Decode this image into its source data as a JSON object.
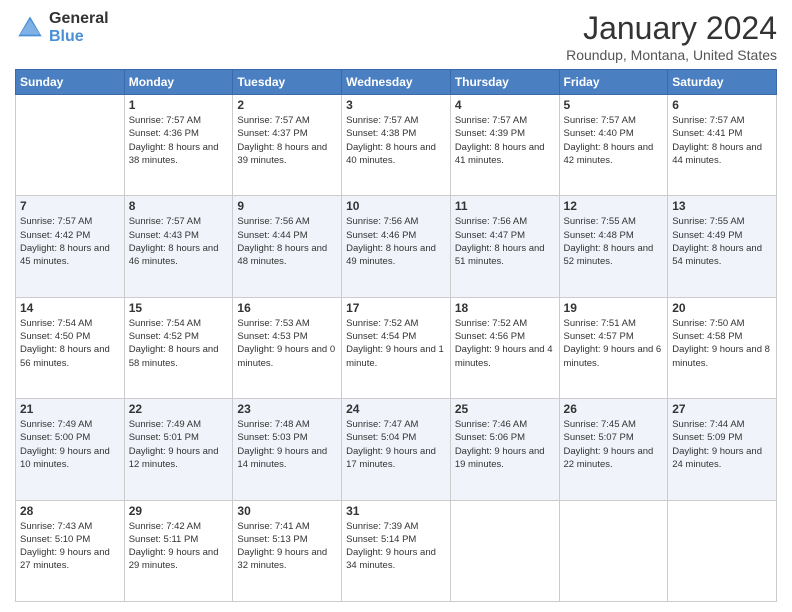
{
  "header": {
    "logo_general": "General",
    "logo_blue": "Blue",
    "month_title": "January 2024",
    "location": "Roundup, Montana, United States"
  },
  "weekdays": [
    "Sunday",
    "Monday",
    "Tuesday",
    "Wednesday",
    "Thursday",
    "Friday",
    "Saturday"
  ],
  "weeks": [
    [
      {
        "day": "",
        "sunrise": "",
        "sunset": "",
        "daylight": ""
      },
      {
        "day": "1",
        "sunrise": "Sunrise: 7:57 AM",
        "sunset": "Sunset: 4:36 PM",
        "daylight": "Daylight: 8 hours and 38 minutes."
      },
      {
        "day": "2",
        "sunrise": "Sunrise: 7:57 AM",
        "sunset": "Sunset: 4:37 PM",
        "daylight": "Daylight: 8 hours and 39 minutes."
      },
      {
        "day": "3",
        "sunrise": "Sunrise: 7:57 AM",
        "sunset": "Sunset: 4:38 PM",
        "daylight": "Daylight: 8 hours and 40 minutes."
      },
      {
        "day": "4",
        "sunrise": "Sunrise: 7:57 AM",
        "sunset": "Sunset: 4:39 PM",
        "daylight": "Daylight: 8 hours and 41 minutes."
      },
      {
        "day": "5",
        "sunrise": "Sunrise: 7:57 AM",
        "sunset": "Sunset: 4:40 PM",
        "daylight": "Daylight: 8 hours and 42 minutes."
      },
      {
        "day": "6",
        "sunrise": "Sunrise: 7:57 AM",
        "sunset": "Sunset: 4:41 PM",
        "daylight": "Daylight: 8 hours and 44 minutes."
      }
    ],
    [
      {
        "day": "7",
        "sunrise": "Sunrise: 7:57 AM",
        "sunset": "Sunset: 4:42 PM",
        "daylight": "Daylight: 8 hours and 45 minutes."
      },
      {
        "day": "8",
        "sunrise": "Sunrise: 7:57 AM",
        "sunset": "Sunset: 4:43 PM",
        "daylight": "Daylight: 8 hours and 46 minutes."
      },
      {
        "day": "9",
        "sunrise": "Sunrise: 7:56 AM",
        "sunset": "Sunset: 4:44 PM",
        "daylight": "Daylight: 8 hours and 48 minutes."
      },
      {
        "day": "10",
        "sunrise": "Sunrise: 7:56 AM",
        "sunset": "Sunset: 4:46 PM",
        "daylight": "Daylight: 8 hours and 49 minutes."
      },
      {
        "day": "11",
        "sunrise": "Sunrise: 7:56 AM",
        "sunset": "Sunset: 4:47 PM",
        "daylight": "Daylight: 8 hours and 51 minutes."
      },
      {
        "day": "12",
        "sunrise": "Sunrise: 7:55 AM",
        "sunset": "Sunset: 4:48 PM",
        "daylight": "Daylight: 8 hours and 52 minutes."
      },
      {
        "day": "13",
        "sunrise": "Sunrise: 7:55 AM",
        "sunset": "Sunset: 4:49 PM",
        "daylight": "Daylight: 8 hours and 54 minutes."
      }
    ],
    [
      {
        "day": "14",
        "sunrise": "Sunrise: 7:54 AM",
        "sunset": "Sunset: 4:50 PM",
        "daylight": "Daylight: 8 hours and 56 minutes."
      },
      {
        "day": "15",
        "sunrise": "Sunrise: 7:54 AM",
        "sunset": "Sunset: 4:52 PM",
        "daylight": "Daylight: 8 hours and 58 minutes."
      },
      {
        "day": "16",
        "sunrise": "Sunrise: 7:53 AM",
        "sunset": "Sunset: 4:53 PM",
        "daylight": "Daylight: 9 hours and 0 minutes."
      },
      {
        "day": "17",
        "sunrise": "Sunrise: 7:52 AM",
        "sunset": "Sunset: 4:54 PM",
        "daylight": "Daylight: 9 hours and 1 minute."
      },
      {
        "day": "18",
        "sunrise": "Sunrise: 7:52 AM",
        "sunset": "Sunset: 4:56 PM",
        "daylight": "Daylight: 9 hours and 4 minutes."
      },
      {
        "day": "19",
        "sunrise": "Sunrise: 7:51 AM",
        "sunset": "Sunset: 4:57 PM",
        "daylight": "Daylight: 9 hours and 6 minutes."
      },
      {
        "day": "20",
        "sunrise": "Sunrise: 7:50 AM",
        "sunset": "Sunset: 4:58 PM",
        "daylight": "Daylight: 9 hours and 8 minutes."
      }
    ],
    [
      {
        "day": "21",
        "sunrise": "Sunrise: 7:49 AM",
        "sunset": "Sunset: 5:00 PM",
        "daylight": "Daylight: 9 hours and 10 minutes."
      },
      {
        "day": "22",
        "sunrise": "Sunrise: 7:49 AM",
        "sunset": "Sunset: 5:01 PM",
        "daylight": "Daylight: 9 hours and 12 minutes."
      },
      {
        "day": "23",
        "sunrise": "Sunrise: 7:48 AM",
        "sunset": "Sunset: 5:03 PM",
        "daylight": "Daylight: 9 hours and 14 minutes."
      },
      {
        "day": "24",
        "sunrise": "Sunrise: 7:47 AM",
        "sunset": "Sunset: 5:04 PM",
        "daylight": "Daylight: 9 hours and 17 minutes."
      },
      {
        "day": "25",
        "sunrise": "Sunrise: 7:46 AM",
        "sunset": "Sunset: 5:06 PM",
        "daylight": "Daylight: 9 hours and 19 minutes."
      },
      {
        "day": "26",
        "sunrise": "Sunrise: 7:45 AM",
        "sunset": "Sunset: 5:07 PM",
        "daylight": "Daylight: 9 hours and 22 minutes."
      },
      {
        "day": "27",
        "sunrise": "Sunrise: 7:44 AM",
        "sunset": "Sunset: 5:09 PM",
        "daylight": "Daylight: 9 hours and 24 minutes."
      }
    ],
    [
      {
        "day": "28",
        "sunrise": "Sunrise: 7:43 AM",
        "sunset": "Sunset: 5:10 PM",
        "daylight": "Daylight: 9 hours and 27 minutes."
      },
      {
        "day": "29",
        "sunrise": "Sunrise: 7:42 AM",
        "sunset": "Sunset: 5:11 PM",
        "daylight": "Daylight: 9 hours and 29 minutes."
      },
      {
        "day": "30",
        "sunrise": "Sunrise: 7:41 AM",
        "sunset": "Sunset: 5:13 PM",
        "daylight": "Daylight: 9 hours and 32 minutes."
      },
      {
        "day": "31",
        "sunrise": "Sunrise: 7:39 AM",
        "sunset": "Sunset: 5:14 PM",
        "daylight": "Daylight: 9 hours and 34 minutes."
      },
      {
        "day": "",
        "sunrise": "",
        "sunset": "",
        "daylight": ""
      },
      {
        "day": "",
        "sunrise": "",
        "sunset": "",
        "daylight": ""
      },
      {
        "day": "",
        "sunrise": "",
        "sunset": "",
        "daylight": ""
      }
    ]
  ]
}
